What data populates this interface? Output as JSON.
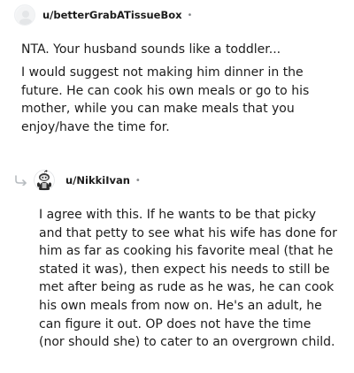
{
  "comment1": {
    "username": "u/betterGrabATissueBox",
    "separator": "•",
    "avatar_icon": "avatar-placeholder-icon",
    "paragraphs": [
      "NTA. Your husband sounds like a toddler...",
      "I would suggest not making him dinner in the future. He can cook his own meals or go to his mother, while you can make meals that you enjoy/have the time for."
    ]
  },
  "comment2": {
    "username": "u/NikkiIvan",
    "separator": "•",
    "avatar_icon": "snoo-avatar-icon",
    "reply_icon": "reply-arrow-icon",
    "paragraphs": [
      "I agree with this. If he wants to be that picky and that petty to see what his wife has done for him as far as cooking his favorite meal (that he stated it was), then expect his needs to still be met after being as rude as he was, he can cook his own meals from now on. He's an adult, he can figure it out. OP does not have the time (nor should she) to cater to an overgrown child."
    ]
  },
  "colors": {
    "text": "#1c1c1c",
    "meta": "#878a8c",
    "avatar_bg": "#edeff1"
  }
}
